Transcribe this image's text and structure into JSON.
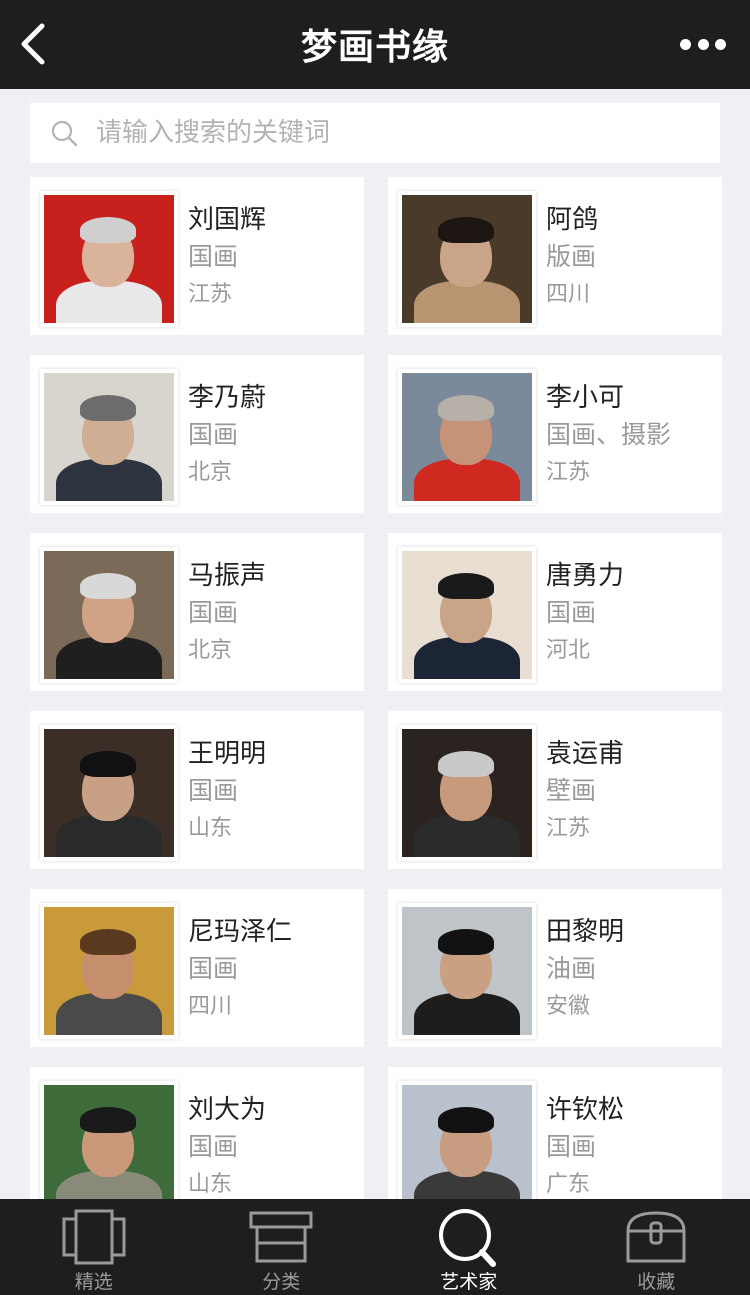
{
  "header": {
    "title": "梦画书缘"
  },
  "search": {
    "placeholder": "请输入搜索的关键词"
  },
  "artists": [
    {
      "name": "刘国辉",
      "category": "国画",
      "location": "江苏",
      "bg": "#c8201d",
      "shirt": "#e8e8ea",
      "hair": "#cfcfcf",
      "skin": "#d9b49a"
    },
    {
      "name": "阿鸽",
      "category": "版画",
      "location": "四川",
      "bg": "#4a3a2a",
      "shirt": "#b89570",
      "hair": "#1c1512",
      "skin": "#c9a487"
    },
    {
      "name": "李乃蔚",
      "category": "国画",
      "location": "北京",
      "bg": "#d8d5cf",
      "shirt": "#2d3440",
      "hair": "#6c6c6c",
      "skin": "#cfae94"
    },
    {
      "name": "李小可",
      "category": "国画、摄影",
      "location": "江苏",
      "bg": "#7a8a9a",
      "shirt": "#d0291f",
      "hair": "#b7b0a8",
      "skin": "#c69378"
    },
    {
      "name": "马振声",
      "category": "国画",
      "location": "北京",
      "bg": "#7b6a58",
      "shirt": "#1f1f1f",
      "hair": "#d8d8d8",
      "skin": "#d1a386"
    },
    {
      "name": "唐勇力",
      "category": "国画",
      "location": "河北",
      "bg": "#e8dfd2",
      "shirt": "#1c2536",
      "hair": "#1a1a1a",
      "skin": "#caa489"
    },
    {
      "name": "王明明",
      "category": "国画",
      "location": "山东",
      "bg": "#3a2e26",
      "shirt": "#2a2a2a",
      "hair": "#111111",
      "skin": "#c8a085"
    },
    {
      "name": "袁运甫",
      "category": "壁画",
      "location": "江苏",
      "bg": "#2a2320",
      "shirt": "#2b2b2b",
      "hair": "#c9c9c9",
      "skin": "#c79a7c"
    },
    {
      "name": "尼玛泽仁",
      "category": "国画",
      "location": "四川",
      "bg": "#c99a3a",
      "shirt": "#4a4a4a",
      "hair": "#5a3a1e",
      "skin": "#c58e6d"
    },
    {
      "name": "田黎明",
      "category": "油画",
      "location": "安徽",
      "bg": "#bfc4c8",
      "shirt": "#1d1d1d",
      "hair": "#121212",
      "skin": "#caa083"
    },
    {
      "name": "刘大为",
      "category": "国画",
      "location": "山东",
      "bg": "#3e6b3a",
      "shirt": "#8a8a7a",
      "hair": "#1a1a1a",
      "skin": "#c9997a"
    },
    {
      "name": "许钦松",
      "category": "国画",
      "location": "广东",
      "bg": "#b9c2cc",
      "shirt": "#3a3a3a",
      "hair": "#111111",
      "skin": "#c89c80"
    }
  ],
  "tabs": [
    {
      "label": "精选",
      "icon": "featured-icon",
      "active": false
    },
    {
      "label": "分类",
      "icon": "category-icon",
      "active": false
    },
    {
      "label": "艺术家",
      "icon": "search-icon",
      "active": true
    },
    {
      "label": "收藏",
      "icon": "collection-icon",
      "active": false
    }
  ]
}
